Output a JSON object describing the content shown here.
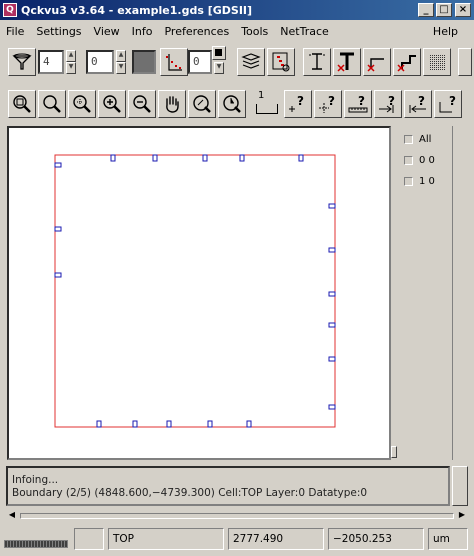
{
  "window": {
    "title": "Qckvu3 v3.64 - example1.gds [GDSII]",
    "minimize": "_",
    "maximize": "□",
    "close": "×"
  },
  "menu": [
    {
      "label": "File"
    },
    {
      "label": "Settings"
    },
    {
      "label": "View"
    },
    {
      "label": "Info"
    },
    {
      "label": "Preferences"
    },
    {
      "label": "Tools"
    },
    {
      "label": "NetTrace"
    },
    {
      "label": "Help"
    }
  ],
  "toolbar1": {
    "filter_depth": "4",
    "filter_level": "0",
    "snap_value": "0",
    "swatch_color": "#707070"
  },
  "toolbar2": {
    "scale_label": "1"
  },
  "layers": [
    {
      "label": "All"
    },
    {
      "label": "0 0"
    },
    {
      "label": "1 0"
    }
  ],
  "info": {
    "line1": "Infoing...",
    "line2": "Boundary (2/5) (4848.600,−4739.300) Cell:TOP Layer:0 Datatype:0"
  },
  "status": {
    "cell": "TOP",
    "x": "2777.490",
    "y": "−2050.253",
    "unit": "um"
  },
  "colors": {
    "boundary": "#e03030",
    "marker": "#1a1ab0",
    "titlebar_start": "#0a246a",
    "titlebar_end": "#3a6ea5"
  }
}
